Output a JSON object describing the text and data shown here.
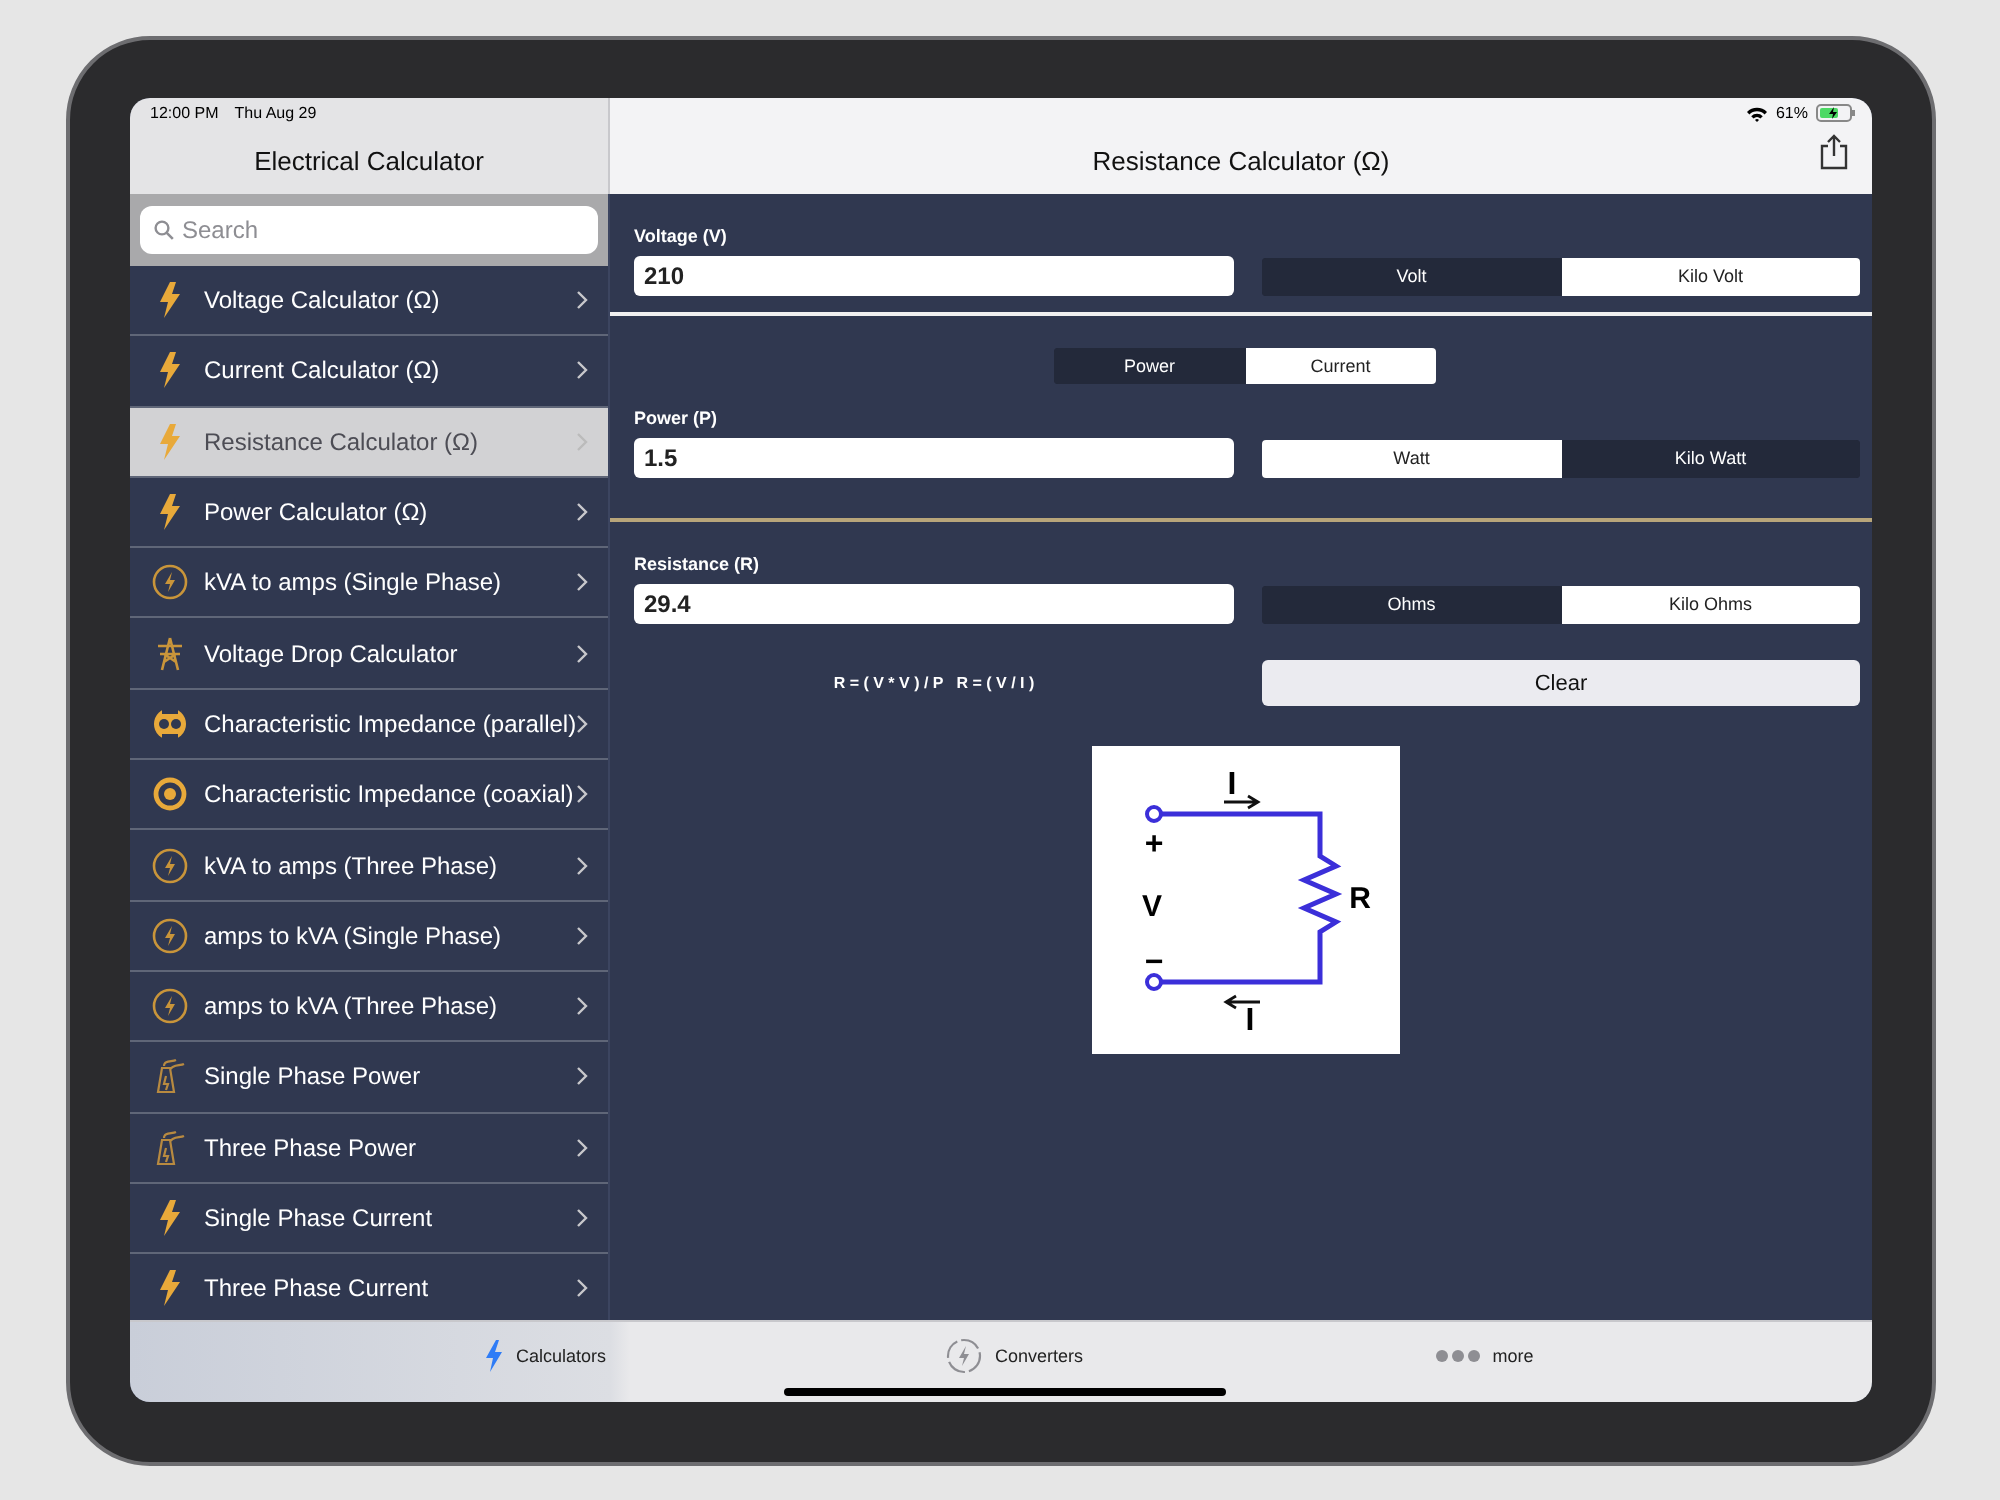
{
  "status_bar": {
    "time": "12:00 PM",
    "date": "Thu Aug 29",
    "battery": "61%"
  },
  "sidebar": {
    "title": "Electrical Calculator",
    "search": {
      "placeholder": "Search"
    },
    "items": [
      {
        "label": "Voltage Calculator (Ω)",
        "kind": "bolt",
        "selected": false
      },
      {
        "label": "Current Calculator (Ω)",
        "kind": "bolt",
        "selected": false
      },
      {
        "label": "Resistance Calculator (Ω)",
        "kind": "bolt",
        "selected": true
      },
      {
        "label": "Power Calculator (Ω)",
        "kind": "bolt",
        "selected": false
      },
      {
        "label": "kVA to amps (Single Phase)",
        "kind": "converter",
        "selected": false
      },
      {
        "label": "Voltage Drop Calculator",
        "kind": "tower",
        "selected": false
      },
      {
        "label": "Characteristic Impedance (parallel)",
        "kind": "parallel",
        "selected": false
      },
      {
        "label": "Characteristic Impedance (coaxial)",
        "kind": "coaxial",
        "selected": false
      },
      {
        "label": "kVA to amps (Three Phase)",
        "kind": "converter",
        "selected": false
      },
      {
        "label": "amps to kVA (Single Phase)",
        "kind": "converter",
        "selected": false
      },
      {
        "label": "amps to kVA (Three Phase)",
        "kind": "converter",
        "selected": false
      },
      {
        "label": "Single Phase Power",
        "kind": "plant",
        "selected": false
      },
      {
        "label": "Three Phase Power",
        "kind": "plant",
        "selected": false
      },
      {
        "label": "Single Phase Current",
        "kind": "bolt",
        "selected": false
      },
      {
        "label": "Three Phase Current",
        "kind": "bolt",
        "selected": false
      }
    ]
  },
  "main": {
    "title": "Resistance Calculator (Ω)",
    "voltage": {
      "label": "Voltage (V)",
      "value": "210",
      "units": [
        {
          "label": "Volt",
          "selected": false
        },
        {
          "label": "Kilo Volt",
          "selected": true
        }
      ]
    },
    "mode": [
      {
        "label": "Power",
        "selected": false
      },
      {
        "label": "Current",
        "selected": true
      }
    ],
    "power": {
      "label": "Power (P)",
      "value": "1.5",
      "units": [
        {
          "label": "Watt",
          "selected": true
        },
        {
          "label": "Kilo Watt",
          "selected": false
        }
      ]
    },
    "resistance": {
      "label": "Resistance (R)",
      "value": "29.4",
      "units": [
        {
          "label": "Ohms",
          "selected": false
        },
        {
          "label": "Kilo Ohms",
          "selected": true
        }
      ]
    },
    "formula": "R = ( V * V ) / P   R = ( V / I )",
    "clear_button": "Clear",
    "diagram": {
      "current_top": "I",
      "current_bottom": "I",
      "plus": "+",
      "minus": "−",
      "voltage": "V",
      "resistance": "R"
    }
  },
  "tab_bar": [
    {
      "label": "Calculators",
      "kind": "bolt",
      "selected": true
    },
    {
      "label": "Converters",
      "kind": "converter",
      "selected": false
    },
    {
      "label": "more",
      "kind": "more",
      "selected": false
    }
  ]
}
